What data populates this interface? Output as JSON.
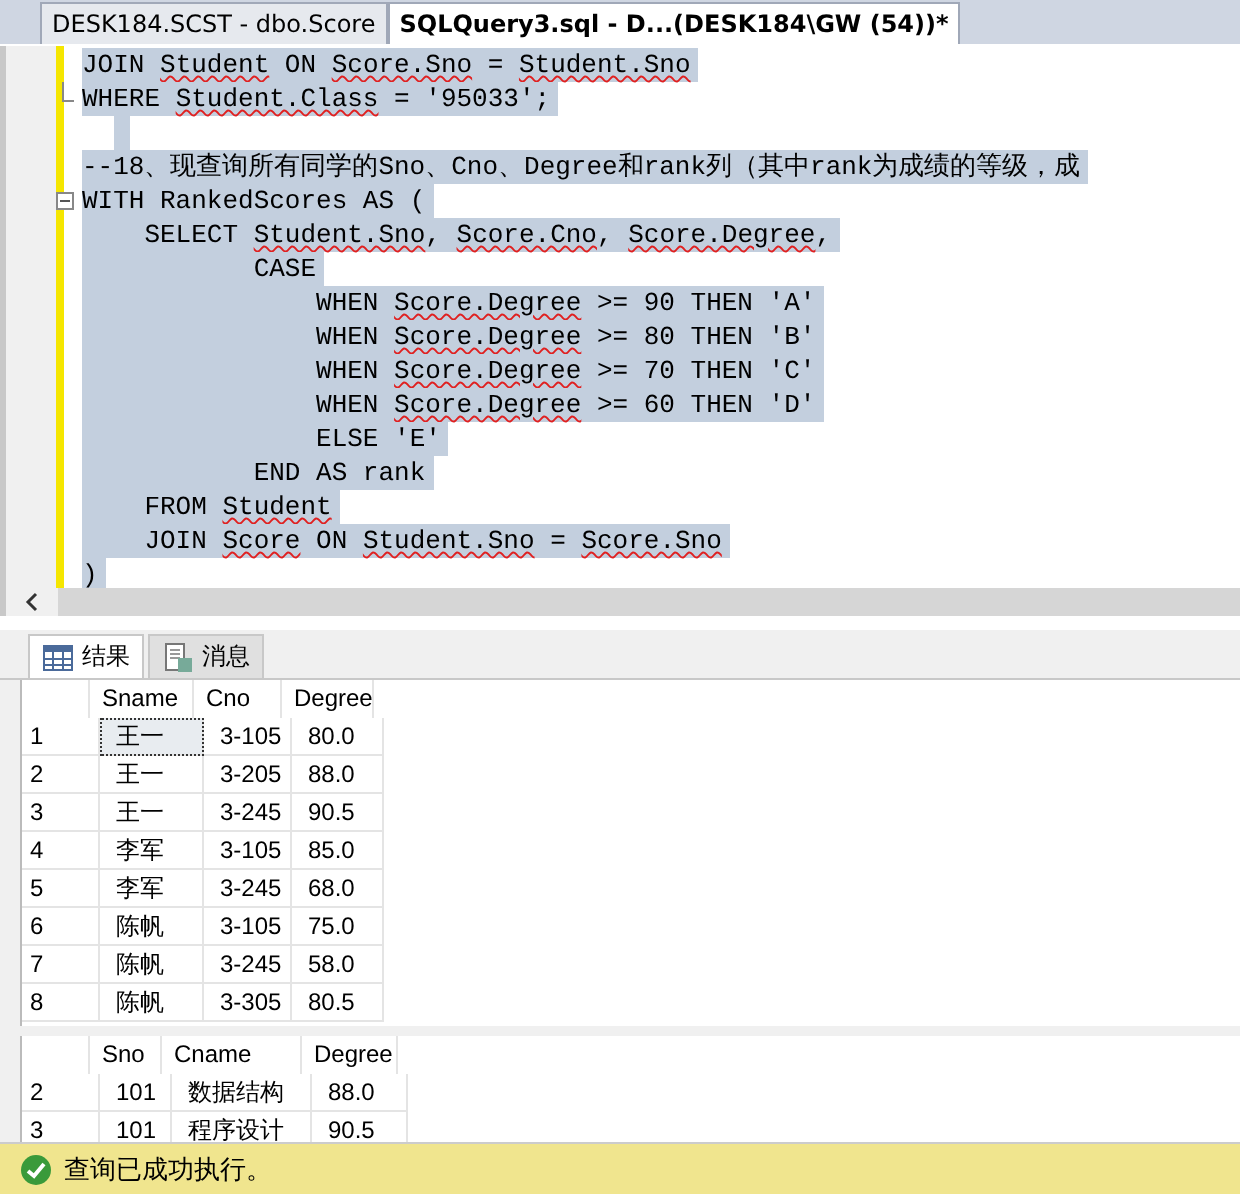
{
  "document_tabs": [
    {
      "label": "DESK184.SCST - dbo.Score",
      "selected": false
    },
    {
      "label": "SQLQuery3.sql - D...(DESK184\\GW (54))*",
      "selected": true
    }
  ],
  "editor": {
    "lines": [
      {
        "kind": "plain",
        "tokens": [
          {
            "text": "JOIN ",
            "error": false
          },
          {
            "text": "Student",
            "error": true
          },
          {
            "text": " ON ",
            "error": false
          },
          {
            "text": "Score.Sno",
            "error": true
          },
          {
            "text": " = ",
            "error": false
          },
          {
            "text": "Student.Sno",
            "error": true
          }
        ]
      },
      {
        "kind": "fold-end",
        "tokens": [
          {
            "text": "WHERE ",
            "error": false
          },
          {
            "text": "Student.Class",
            "error": true
          },
          {
            "text": " = '95033';",
            "error": false
          }
        ]
      },
      {
        "kind": "blank"
      },
      {
        "kind": "plain",
        "tokens": [
          {
            "text": "--18、现查询所有同学的Sno、Cno、Degree和rank列（其中rank为成绩的等级，成",
            "error": false
          }
        ]
      },
      {
        "kind": "fold-start",
        "tokens": [
          {
            "text": "WITH RankedScores AS (",
            "error": false
          }
        ]
      },
      {
        "kind": "plain",
        "tokens": [
          {
            "text": "    SELECT ",
            "error": false
          },
          {
            "text": "Student.Sno",
            "error": true
          },
          {
            "text": ", ",
            "error": false
          },
          {
            "text": "Score.Cno",
            "error": true
          },
          {
            "text": ", ",
            "error": false
          },
          {
            "text": "Score.Degree",
            "error": true
          },
          {
            "text": ",",
            "error": false
          }
        ]
      },
      {
        "kind": "plain",
        "tokens": [
          {
            "text": "           CASE",
            "error": false
          }
        ]
      },
      {
        "kind": "plain",
        "tokens": [
          {
            "text": "               WHEN ",
            "error": false
          },
          {
            "text": "Score.Degree",
            "error": true
          },
          {
            "text": " >= 90 THEN 'A'",
            "error": false
          }
        ]
      },
      {
        "kind": "plain",
        "tokens": [
          {
            "text": "               WHEN ",
            "error": false
          },
          {
            "text": "Score.Degree",
            "error": true
          },
          {
            "text": " >= 80 THEN 'B'",
            "error": false
          }
        ]
      },
      {
        "kind": "plain",
        "tokens": [
          {
            "text": "               WHEN ",
            "error": false
          },
          {
            "text": "Score.Degree",
            "error": true
          },
          {
            "text": " >= 70 THEN 'C'",
            "error": false
          }
        ]
      },
      {
        "kind": "plain",
        "tokens": [
          {
            "text": "               WHEN ",
            "error": false
          },
          {
            "text": "Score.Degree",
            "error": true
          },
          {
            "text": " >= 60 THEN 'D'",
            "error": false
          }
        ]
      },
      {
        "kind": "plain",
        "tokens": [
          {
            "text": "               ELSE 'E'",
            "error": false
          }
        ]
      },
      {
        "kind": "plain",
        "tokens": [
          {
            "text": "           END AS rank",
            "error": false
          }
        ]
      },
      {
        "kind": "plain",
        "tokens": [
          {
            "text": "    FROM ",
            "error": false
          },
          {
            "text": "Student",
            "error": true
          }
        ]
      },
      {
        "kind": "plain",
        "tokens": [
          {
            "text": "    JOIN ",
            "error": false
          },
          {
            "text": "Score",
            "error": true
          },
          {
            "text": " ON ",
            "error": false
          },
          {
            "text": "Student.Sno",
            "error": true
          },
          {
            "text": " = ",
            "error": false
          },
          {
            "text": "Score.Sno",
            "error": true
          }
        ]
      },
      {
        "kind": "plain",
        "tokens": [
          {
            "text": ")",
            "error": false
          }
        ]
      }
    ]
  },
  "result_tabs": [
    {
      "label": "结果",
      "kind": "grid",
      "selected": true
    },
    {
      "label": "消息",
      "kind": "messages",
      "selected": false
    }
  ],
  "grids": [
    {
      "columns": [
        "Sname",
        "Cno",
        "Degree"
      ],
      "rows": [
        {
          "number": "1",
          "cells": [
            "王一",
            "3-105",
            "80.0"
          ],
          "focused": true
        },
        {
          "number": "2",
          "cells": [
            "王一",
            "3-205",
            "88.0"
          ],
          "focused": false
        },
        {
          "number": "3",
          "cells": [
            "王一",
            "3-245",
            "90.5"
          ],
          "focused": false
        },
        {
          "number": "4",
          "cells": [
            "李军",
            "3-105",
            "85.0"
          ],
          "focused": false
        },
        {
          "number": "5",
          "cells": [
            "李军",
            "3-245",
            "68.0"
          ],
          "focused": false
        },
        {
          "number": "6",
          "cells": [
            "陈帆",
            "3-105",
            "75.0"
          ],
          "focused": false
        },
        {
          "number": "7",
          "cells": [
            "陈帆",
            "3-245",
            "58.0"
          ],
          "focused": false
        },
        {
          "number": "8",
          "cells": [
            "陈帆",
            "3-305",
            "80.5"
          ],
          "focused": false
        }
      ]
    },
    {
      "columns": [
        "Sno",
        "Cname",
        "Degree"
      ],
      "rows": [
        {
          "number": "2",
          "cells": [
            "101",
            "数据结构",
            "88.0"
          ],
          "focused": false
        },
        {
          "number": "3",
          "cells": [
            "101",
            "程序设计",
            "90.5"
          ],
          "focused": false
        }
      ]
    }
  ],
  "status_bar": {
    "message": "查询已成功执行。"
  }
}
